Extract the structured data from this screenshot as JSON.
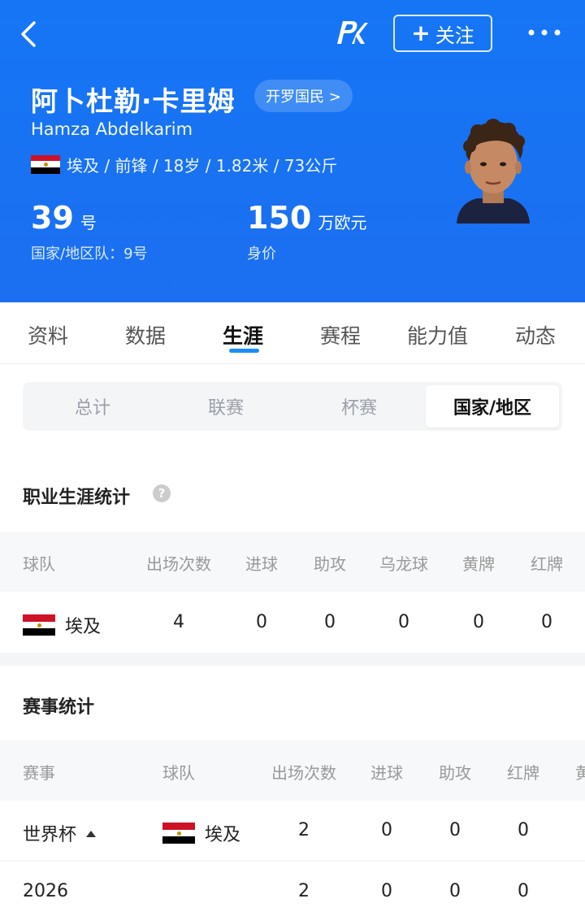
{
  "header": {
    "follow_label": "关注",
    "player_name": "阿卜杜勒·卡里姆",
    "club": "开罗国民 >",
    "player_name_en": "Hamza Abdelkarim",
    "info": "埃及 / 前锋 / 18岁 / 1.82米 / 73公斤",
    "number": "39",
    "number_unit": "号",
    "national_number": "国家/地区队：9号",
    "value": "150",
    "value_unit": "万欧元",
    "value_label": "身价"
  },
  "tabs": [
    "资料",
    "数据",
    "生涯",
    "赛程",
    "能力值",
    "动态"
  ],
  "active_tab": "生涯",
  "segments": [
    "总计",
    "联赛",
    "杯赛",
    "国家/地区"
  ],
  "active_segment": "国家/地区",
  "career": {
    "title": "职业生涯统计",
    "help_icon": "?",
    "headers": [
      "球队",
      "出场次数",
      "进球",
      "助攻",
      "乌龙球",
      "黄牌",
      "红牌"
    ],
    "rows": [
      {
        "team": "埃及",
        "apps": "4",
        "goals": "0",
        "assists": "0",
        "own_goals": "0",
        "yellow": "0",
        "red": "0"
      }
    ]
  },
  "competition": {
    "title": "赛事统计",
    "headers": [
      "赛事",
      "球队",
      "出场次数",
      "进球",
      "助攻",
      "红牌",
      "黄"
    ],
    "rows": [
      {
        "competition": "世界杯",
        "team": "埃及",
        "apps": "2",
        "goals": "0",
        "assists": "0",
        "red": "0"
      },
      {
        "competition": "2026",
        "team": "",
        "apps": "2",
        "goals": "0",
        "assists": "0",
        "red": "0"
      }
    ]
  },
  "colors": {
    "header_bg": "#1576f5",
    "accent": "#1a8ef7"
  }
}
